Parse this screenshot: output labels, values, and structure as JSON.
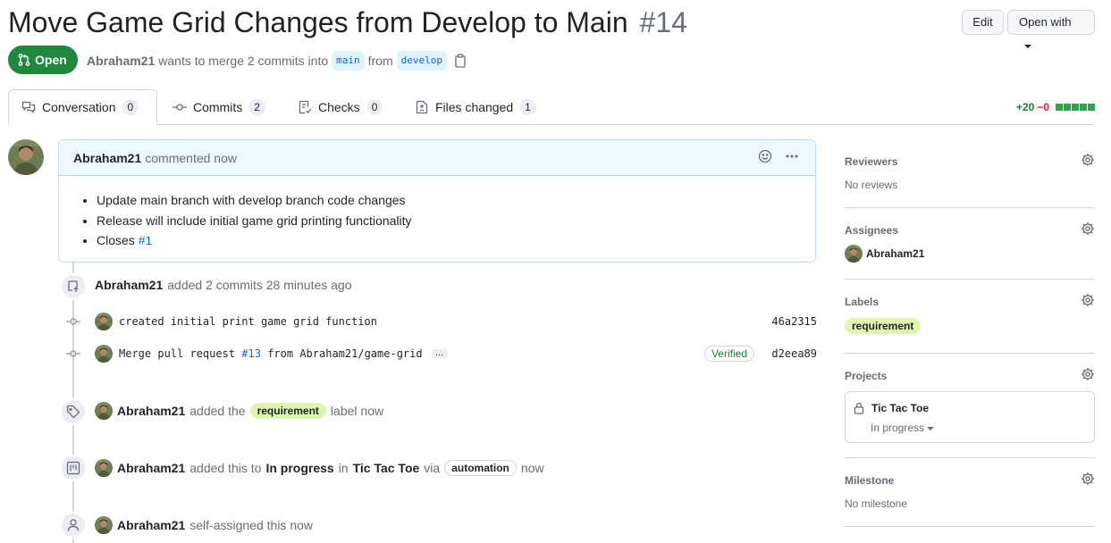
{
  "pr": {
    "title": "Move Game Grid Changes from Develop to Main",
    "number": "#14",
    "state": "Open",
    "author": "Abraham21",
    "merge_text": "wants to merge 2 commits into",
    "base_branch": "main",
    "from_text": "from",
    "head_branch": "develop"
  },
  "header": {
    "edit_label": "Edit",
    "open_with_label": "Open with"
  },
  "tabs": [
    {
      "label": "Conversation",
      "count": "0",
      "icon": "comment-discussion-icon"
    },
    {
      "label": "Commits",
      "count": "2",
      "icon": "git-commit-icon"
    },
    {
      "label": "Checks",
      "count": "0",
      "icon": "checklist-icon"
    },
    {
      "label": "Files changed",
      "count": "1",
      "icon": "file-diff-icon"
    }
  ],
  "diffstat": {
    "additions": "+20",
    "deletions": "−0"
  },
  "comment": {
    "author": "Abraham21",
    "action": "commented now",
    "items": [
      "Update main branch with develop branch code changes",
      "Release will include initial game grid printing functionality"
    ],
    "closes_text": "Closes",
    "closes_ref": "#1"
  },
  "timeline": {
    "commits_event": {
      "author": "Abraham21",
      "text": "added 2 commits 28 minutes ago"
    },
    "commits": [
      {
        "message": "created initial print game grid function",
        "sha": "46a2315"
      },
      {
        "message_pre": "Merge pull request",
        "pr_ref": "#13",
        "message_post": "from Abraham21/game-grid",
        "more": "…",
        "verified": "Verified",
        "sha": "d2eea89"
      }
    ],
    "label_event": {
      "author": "Abraham21",
      "pre": "added the",
      "label": "requirement",
      "post": "label now"
    },
    "project_event": {
      "author": "Abraham21",
      "pre": "added this to",
      "column": "In progress",
      "in": "in",
      "project": "Tic Tac Toe",
      "via": "via",
      "bot": "automation",
      "post": "now"
    },
    "assign_event": {
      "author": "Abraham21",
      "text": "self-assigned this now"
    }
  },
  "sidebar": {
    "reviewers": {
      "title": "Reviewers",
      "value": "No reviews"
    },
    "assignees": {
      "title": "Assignees",
      "value": "Abraham21"
    },
    "labels": {
      "title": "Labels",
      "value": "requirement"
    },
    "projects": {
      "title": "Projects",
      "project": "Tic Tac Toe",
      "status": "In progress"
    },
    "milestone": {
      "title": "Milestone",
      "value": "No milestone"
    }
  },
  "colors": {
    "open_green": "#1f883d",
    "link_blue": "#0969da",
    "label_green": "#dff6b2"
  }
}
